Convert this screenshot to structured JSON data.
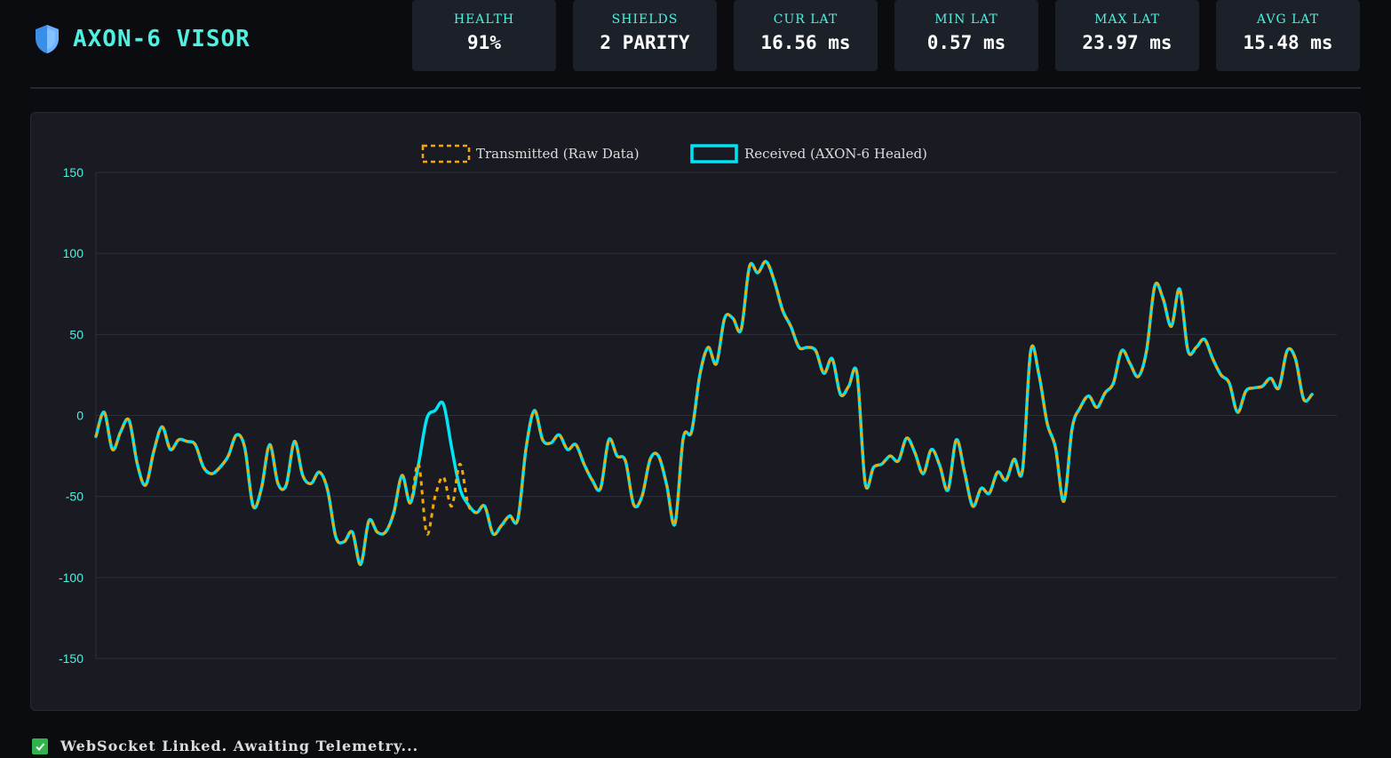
{
  "app": {
    "title": "AXON-6 VISOR",
    "icon": "shield-icon"
  },
  "metrics": [
    {
      "label": "HEALTH",
      "value": "91%"
    },
    {
      "label": "SHIELDS",
      "value": "2 PARITY"
    },
    {
      "label": "CUR LAT",
      "value": "16.56 ms"
    },
    {
      "label": "MIN LAT",
      "value": "0.57 ms"
    },
    {
      "label": "MAX LAT",
      "value": "23.97 ms"
    },
    {
      "label": "AVG LAT",
      "value": "15.48 ms"
    }
  ],
  "status": {
    "icon": "check-icon",
    "text": "WebSocket Linked. Awaiting Telemetry..."
  },
  "colors": {
    "accent": "#4ef0e0",
    "received": "#00e5f5",
    "transmitted": "#f5a800",
    "panel": "#1a1b22"
  },
  "chart_data": {
    "type": "line",
    "title": "",
    "xlabel": "",
    "ylabel": "",
    "ylim": [
      -150,
      150
    ],
    "yticks": [
      150,
      100,
      50,
      0,
      -50,
      -100,
      -150
    ],
    "grid": true,
    "legend_position": "top-center",
    "x": [
      0,
      1,
      2,
      3,
      4,
      5,
      6,
      7,
      8,
      9,
      10,
      11,
      12,
      13,
      14,
      15,
      16,
      17,
      18,
      19,
      20,
      21,
      22,
      23,
      24,
      25,
      26,
      27,
      28,
      29,
      30,
      31,
      32,
      33,
      34,
      35,
      36,
      37,
      38,
      39,
      40,
      41,
      42,
      43,
      44,
      45,
      46,
      47,
      48,
      49,
      50,
      51,
      52,
      53,
      54,
      55,
      56,
      57,
      58,
      59,
      60,
      61,
      62,
      63,
      64,
      65,
      66,
      67,
      68,
      69,
      70,
      71,
      72,
      73,
      74,
      75,
      76,
      77,
      78,
      79,
      80,
      81,
      82,
      83,
      84,
      85,
      86,
      87,
      88,
      89,
      90,
      91,
      92,
      93,
      94,
      95,
      96,
      97,
      98,
      99,
      100,
      101,
      102,
      103,
      104,
      105,
      106,
      107,
      108,
      109,
      110,
      111,
      112,
      113,
      114,
      115,
      116,
      117,
      118,
      119,
      120,
      121,
      122,
      123,
      124,
      125,
      126,
      127,
      128,
      129,
      130,
      131,
      132,
      133,
      134,
      135,
      136,
      137,
      138,
      139,
      140,
      141,
      142,
      143,
      144,
      145,
      146,
      147,
      148,
      149,
      150
    ],
    "series": [
      {
        "name": "Transmitted (Raw Data)",
        "color": "#f5a800",
        "dashed": true,
        "values": [
          -13,
          2,
          -21,
          -10,
          -3,
          -30,
          -43,
          -22,
          -7,
          -21,
          -15,
          -16,
          -18,
          -32,
          -36,
          -32,
          -25,
          -12,
          -20,
          -56,
          -45,
          -18,
          -42,
          -43,
          -16,
          -37,
          -42,
          -35,
          -46,
          -75,
          -78,
          -72,
          -92,
          -65,
          -72,
          -72,
          -60,
          -37,
          -54,
          -30,
          -73,
          -50,
          -38,
          -56,
          -30,
          -55,
          -60,
          -56,
          -73,
          -68,
          -62,
          -64,
          -20,
          3,
          -15,
          -17,
          -12,
          -21,
          -18,
          -30,
          -40,
          -45,
          -15,
          -25,
          -28,
          -55,
          -50,
          -27,
          -25,
          -43,
          -67,
          -14,
          -10,
          25,
          42,
          32,
          60,
          60,
          53,
          92,
          88,
          95,
          83,
          65,
          55,
          42,
          42,
          40,
          26,
          35,
          13,
          18,
          26,
          -42,
          -32,
          -30,
          -25,
          -28,
          -14,
          -23,
          -36,
          -21,
          -31,
          -46,
          -15,
          -35,
          -56,
          -45,
          -48,
          -35,
          -40,
          -27,
          -34,
          40,
          25,
          -5,
          -20,
          -53,
          -8,
          5,
          12,
          5,
          14,
          20,
          40,
          32,
          24,
          40,
          80,
          72,
          55,
          78,
          40,
          42,
          47,
          35,
          25,
          20,
          2,
          15,
          17,
          18,
          23,
          17,
          40,
          35,
          10,
          13
        ]
      },
      {
        "name": "Received (AXON-6 Healed)",
        "color": "#00e5f5",
        "dashed": false,
        "values": [
          -13,
          2,
          -21,
          -10,
          -3,
          -30,
          -43,
          -22,
          -7,
          -21,
          -15,
          -16,
          -18,
          -32,
          -36,
          -32,
          -25,
          -12,
          -20,
          -56,
          -45,
          -18,
          -42,
          -43,
          -16,
          -37,
          -42,
          -35,
          -46,
          -75,
          -78,
          -72,
          -92,
          -65,
          -72,
          -72,
          -60,
          -37,
          -54,
          -30,
          -2,
          3,
          7,
          -20,
          -45,
          -55,
          -60,
          -56,
          -73,
          -68,
          -62,
          -64,
          -20,
          3,
          -15,
          -17,
          -12,
          -21,
          -18,
          -30,
          -40,
          -45,
          -15,
          -25,
          -28,
          -55,
          -50,
          -27,
          -25,
          -43,
          -67,
          -14,
          -10,
          25,
          42,
          32,
          60,
          60,
          53,
          92,
          88,
          95,
          83,
          65,
          55,
          42,
          42,
          40,
          26,
          35,
          13,
          18,
          26,
          -42,
          -32,
          -30,
          -25,
          -28,
          -14,
          -23,
          -36,
          -21,
          -31,
          -46,
          -15,
          -35,
          -56,
          -45,
          -48,
          -35,
          -40,
          -27,
          -34,
          40,
          25,
          -5,
          -20,
          -53,
          -8,
          5,
          12,
          5,
          14,
          20,
          40,
          32,
          24,
          40,
          80,
          72,
          55,
          78,
          40,
          42,
          47,
          35,
          25,
          20,
          2,
          15,
          17,
          18,
          23,
          17,
          40,
          35,
          10,
          13
        ]
      }
    ]
  }
}
